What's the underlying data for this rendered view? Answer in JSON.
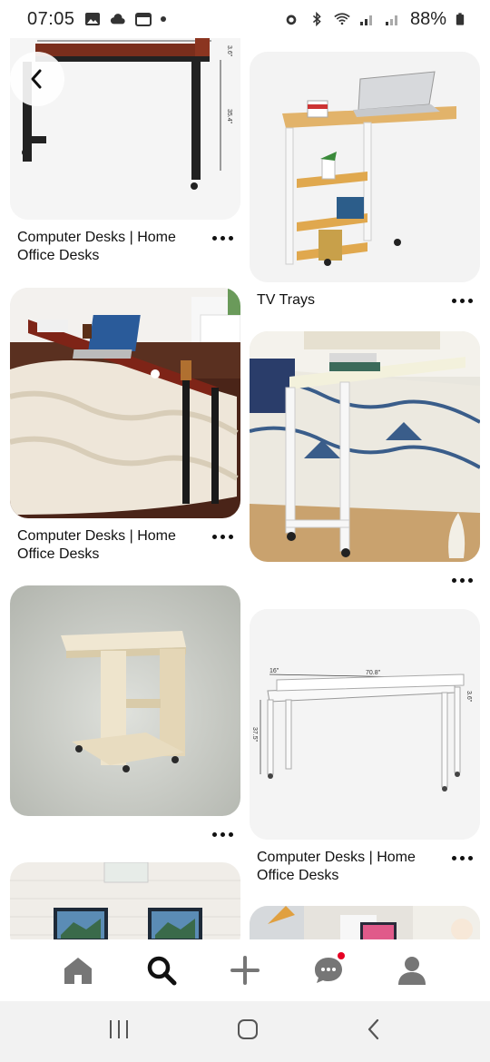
{
  "status": {
    "time": "07:05",
    "battery": "88%"
  },
  "pins": {
    "left": [
      {
        "title": "Computer Desks | Home Office Desks"
      },
      {
        "title": "Computer Desks | Home Office Desks"
      },
      {
        "title": ""
      },
      {
        "title": ""
      }
    ],
    "right": [
      {
        "title": "TV Trays"
      },
      {
        "title": ""
      },
      {
        "title": "Computer Desks | Home Office Desks"
      },
      {
        "title": ""
      }
    ]
  },
  "dimensions": {
    "desk1": {
      "height": "35.4\"",
      "rail": "3.6\""
    },
    "desk2": {
      "depth": "16\"",
      "width": "70.8\"",
      "height": "37.5\"",
      "rail": "3.6\""
    }
  },
  "nav": {
    "items": [
      "home-icon",
      "search-icon",
      "create-icon",
      "messages-icon",
      "profile-icon"
    ],
    "active": "search-icon"
  },
  "colors": {
    "accent": "#e60023",
    "icon_gray": "#767676"
  }
}
